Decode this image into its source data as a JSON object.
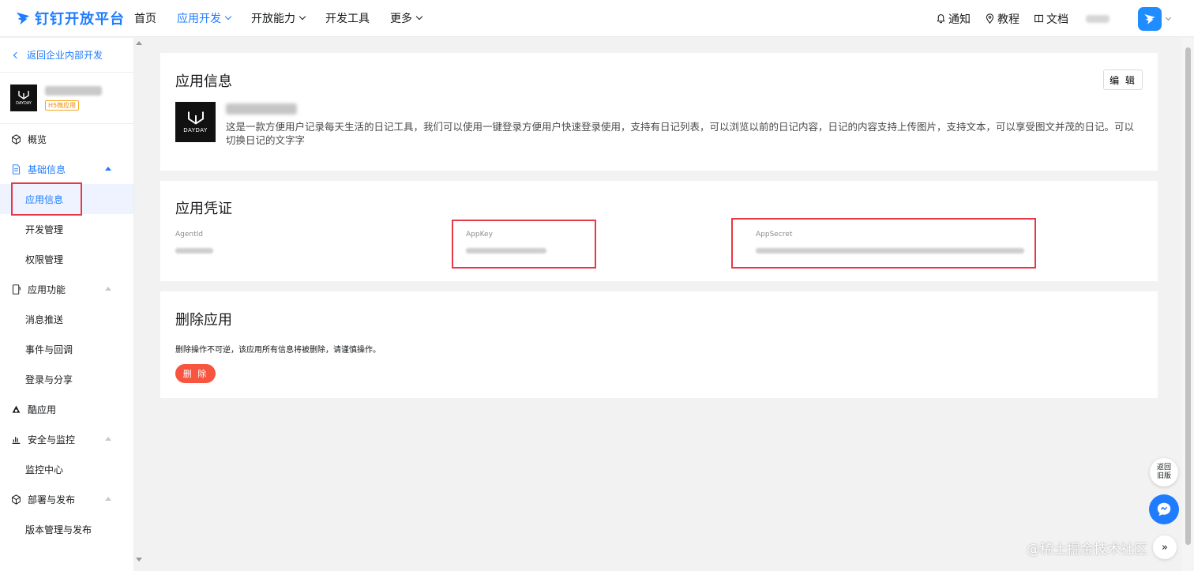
{
  "header": {
    "logo_text": "钉钉开放平台",
    "nav": [
      {
        "label": "首页",
        "active": false,
        "dropdown": false
      },
      {
        "label": "应用开发",
        "active": true,
        "dropdown": true
      },
      {
        "label": "开放能力",
        "active": false,
        "dropdown": true
      },
      {
        "label": "开发工具",
        "active": false,
        "dropdown": false
      },
      {
        "label": "更多",
        "active": false,
        "dropdown": true
      }
    ],
    "links": {
      "notify": "通知",
      "tutorial": "教程",
      "docs": "文档"
    }
  },
  "sidebar": {
    "back_label": "返回企业内部开发",
    "app_tag": "H5微应用",
    "app_icon_text": "DAYDAY",
    "menu": {
      "overview": "概览",
      "basic_info": "基础信息",
      "app_info": "应用信息",
      "dev_manage": "开发管理",
      "perm_manage": "权限管理",
      "app_features": "应用功能",
      "msg_push": "消息推送",
      "event_callback": "事件与回调",
      "login_share": "登录与分享",
      "cool_app": "酷应用",
      "security": "安全与监控",
      "monitor_center": "监控中心",
      "deploy": "部署与发布",
      "version_manage": "版本管理与发布"
    }
  },
  "app_info": {
    "title": "应用信息",
    "edit_label": "编 辑",
    "icon_text": "DAYDAY",
    "description": "这是一款方便用户记录每天生活的日记工具，我们可以使用一键登录方便用户快速登录使用，支持有日记列表，可以浏览以前的日记内容，日记的内容支持上传图片，支持文本，可以享受图文并茂的日记。可以切换日记的文字字"
  },
  "credentials": {
    "title": "应用凭证",
    "agent_id_label": "AgentId",
    "app_key_label": "AppKey",
    "app_secret_label": "AppSecret"
  },
  "delete_section": {
    "title": "删除应用",
    "description": "删除操作不可逆，该应用所有信息将被删除，请谨慎操作。",
    "button_label": "删 除"
  },
  "floating": {
    "old_version_line1": "返回",
    "old_version_line2": "旧版",
    "collapse": "»"
  },
  "watermark": "@稀土掘金技术社区",
  "colors": {
    "accent": "#1f7cff",
    "danger": "#f7553f",
    "highlight_box": "#e63946",
    "tag": "#f28b00"
  }
}
